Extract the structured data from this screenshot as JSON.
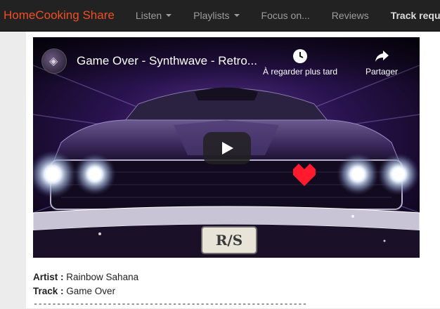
{
  "navbar": {
    "brand": "HomeCooking Share",
    "items": [
      {
        "label": "Listen",
        "dropdown": true
      },
      {
        "label": "Playlists",
        "dropdown": true
      },
      {
        "label": "Focus on...",
        "dropdown": false
      },
      {
        "label": "Reviews",
        "dropdown": false
      },
      {
        "label": "Track requ",
        "dropdown": false
      }
    ],
    "colors": {
      "background": "#222222",
      "brand": "#f04e23"
    }
  },
  "video": {
    "title": "Game Over - Synthwave - Retro...",
    "watch_later_label": "À regarder plus tard",
    "share_label": "Partager",
    "icons": [
      "clock-icon",
      "share-icon",
      "play-icon"
    ],
    "plate_text": "R/S"
  },
  "track": {
    "artist_label": "Artist :",
    "artist": "Rainbow Sahana",
    "track_label": "Track :",
    "track": "Game Over",
    "divider": "-----------------------------------------------------------"
  }
}
